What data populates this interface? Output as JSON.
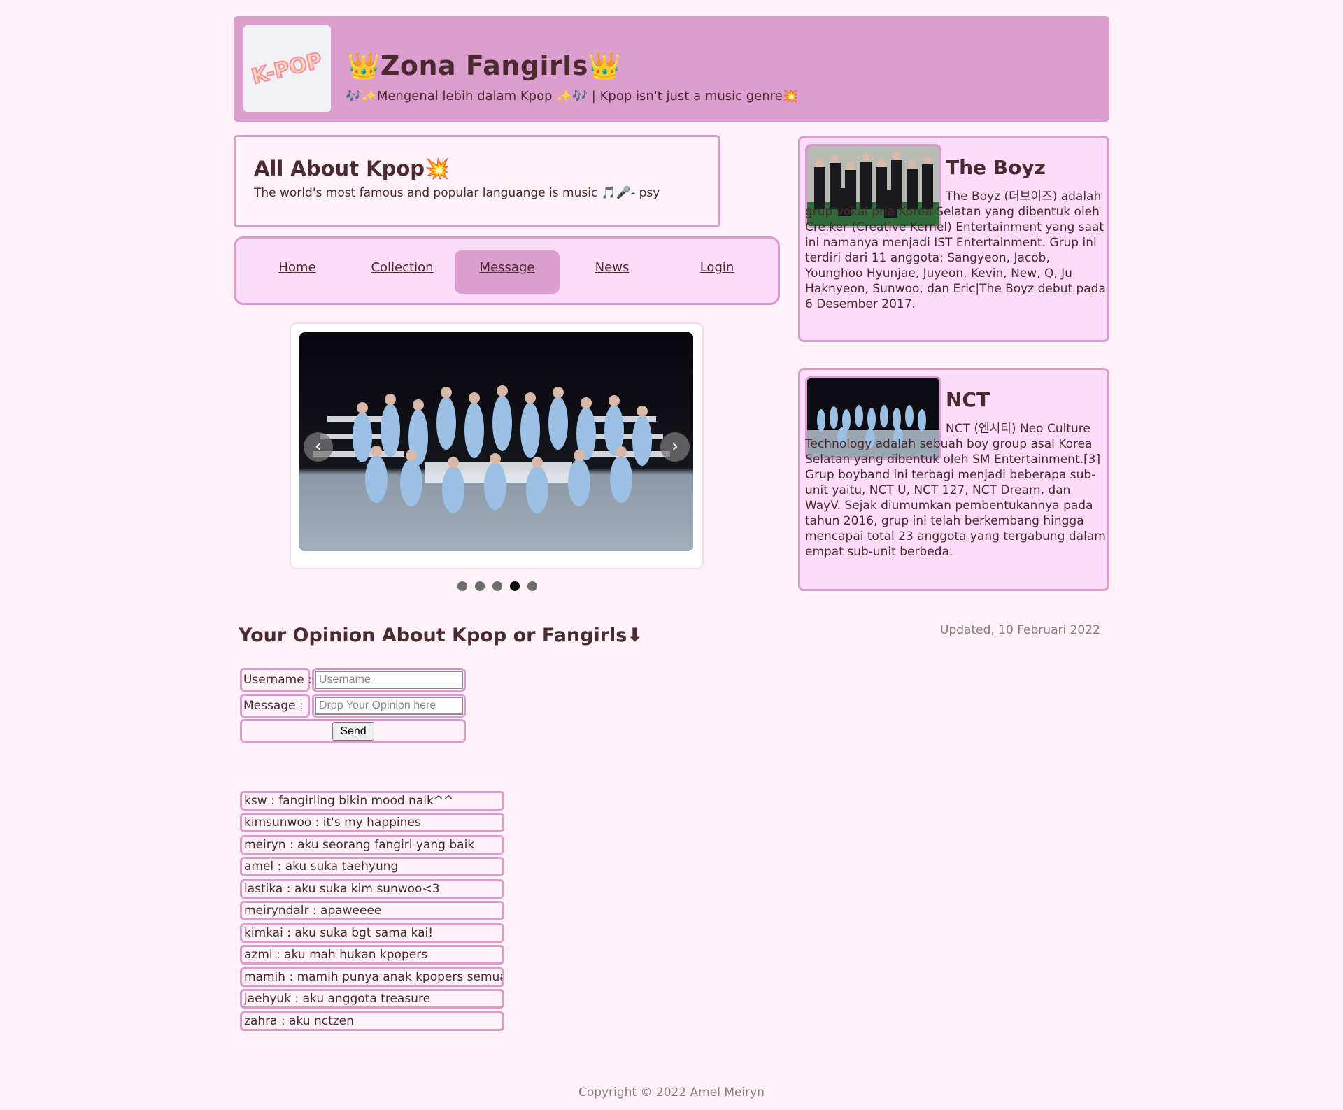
{
  "header": {
    "logo_text": "K-POP",
    "title": "👑Zona Fangirls👑",
    "subtitle": "🎶✨Mengenal lebih dalam Kpop ✨🎶 | Kpop isn't just a music genre💥"
  },
  "about": {
    "title": "All About Kpop💥",
    "quote": "The world's most famous and popular languange is music 🎵🎤- psy"
  },
  "nav": {
    "items": [
      {
        "label": "Home",
        "active": false
      },
      {
        "label": "Collection",
        "active": false
      },
      {
        "label": "Message",
        "active": true
      },
      {
        "label": "News",
        "active": false
      },
      {
        "label": "Login",
        "active": false
      }
    ]
  },
  "carousel": {
    "prev_icon": "chevron-left-icon",
    "next_icon": "chevron-right-icon",
    "slide_count": 5,
    "active_index": 3
  },
  "cards": [
    {
      "title": "The Boyz",
      "text": "The Boyz (더보이즈) adalah grup vokal pria Korea Selatan yang dibentuk oleh Cre.ker (Creative Kernel) Entertainment yang saat ini namanya menjadi IST Entertainment. Grup ini terdiri dari 11 anggota: Sangyeon, Jacob, Younghoo Hyunjae, Juyeon, Kevin, New, Q, Ju Haknyeon, Sunwoo, dan Eric|The Boyz debut pada 6 Desember 2017."
    },
    {
      "title": "NCT",
      "text": "NCT (엔시티) Neo Culture Technology adalah sebuah boy group asal Korea Selatan yang dibentuk oleh SM Entertainment.[3] Grup boyband ini terbagi menjadi beberapa sub-unit yaitu, NCT U, NCT 127, NCT Dream, dan WayV. Sejak diumumkan pembentukannya pada tahun 2016, grup ini telah berkembang hingga mencapai total 23 anggota yang tergabung dalam empat sub-unit berbeda."
    }
  ],
  "updated": "Updated, 10 Februari 2022",
  "opinion": {
    "title": "Your Opinion About Kpop or Fangirls⬇",
    "username_label": "Username :",
    "username_placeholder": "Username",
    "message_label": "Message :",
    "message_placeholder": "Drop Your Opinion here",
    "send_label": "Send"
  },
  "comments": [
    "ksw : fangirling bikin mood naik^^",
    "kimsunwoo : it's my happines",
    "meiryn : aku seorang fangirl yang baik",
    "amel : aku suka taehyung",
    "lastika : aku suka kim sunwoo<3",
    "meiryndalr : apaweeee",
    "kimkai : aku suka bgt sama kai!",
    "azmi : aku mah hukan kpopers",
    "mamih : mamih punya anak kpopers semua",
    "jaehyuk : aku anggota treasure",
    "zahra : aku nctzen"
  ],
  "footer": "Copyright © 2022 Amel Meiryn",
  "colors": {
    "background": "#fcf2f8",
    "header": "#dc9ecf",
    "panel": "#fddcfb",
    "border": "#d99ccd",
    "text": "#4a2a2e"
  }
}
